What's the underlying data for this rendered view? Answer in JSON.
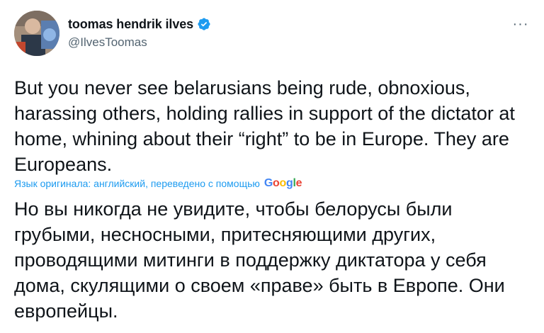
{
  "author": {
    "display_name": "toomas hendrik ilves",
    "handle": "@IlvesToomas",
    "verified": true,
    "avatar_icon": "profile-photo"
  },
  "tweet": {
    "text": "But you never see belarusians being rude, obnoxious, harassing others, holding rallies in support of the dictator at home, whining about their “right” to be in Europe. They are Europeans.",
    "more_icon": "ellipsis-icon"
  },
  "translation": {
    "note": "Язык оригинала: английский, переведено с помощью",
    "provider_letters": [
      "G",
      "o",
      "o",
      "g",
      "l",
      "e"
    ],
    "text": "Но вы никогда не увидите, чтобы белорусы были грубыми, несносными, притесняющими других, проводящими митинги в поддержку диктатора у себя дома, скулящими о своем «праве» быть в Европе. Они европейцы."
  },
  "colors": {
    "link": "#1d9bf0",
    "verified_badge": "#1d9bf0",
    "secondary_text": "#536471",
    "primary_text": "#0f1419"
  }
}
